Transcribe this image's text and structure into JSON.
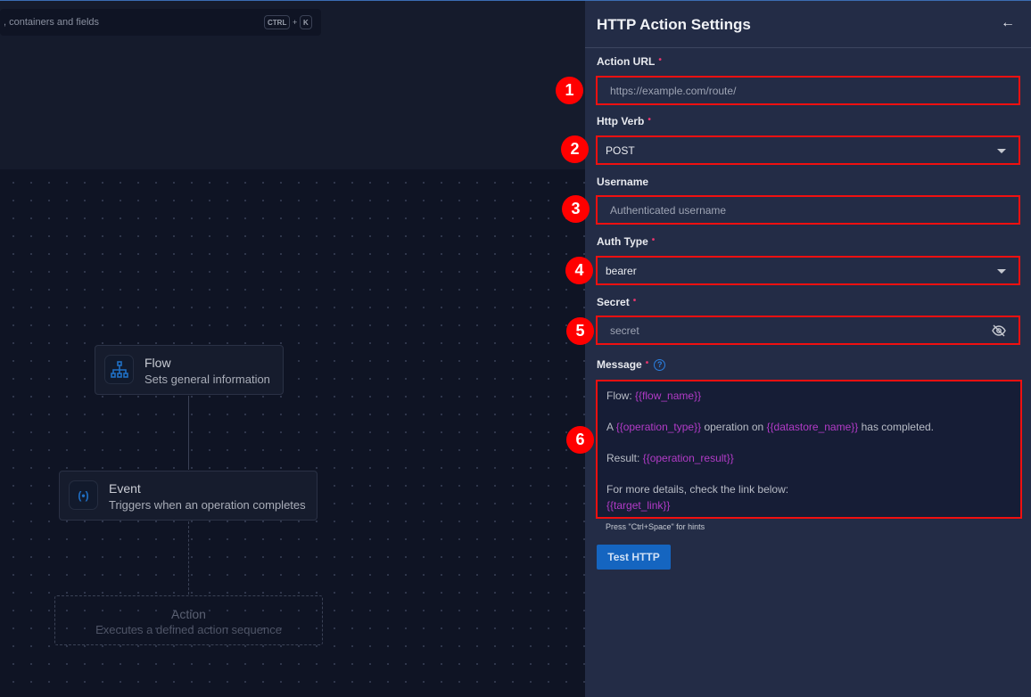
{
  "search": {
    "placeholder_fragment": ", containers and fields",
    "shortcut_key1": "CTRL",
    "shortcut_plus": "+",
    "shortcut_key2": "K"
  },
  "canvas": {
    "nodes": [
      {
        "title": "Flow",
        "subtitle": "Sets general information",
        "icon": "sitemap-icon"
      },
      {
        "title": "Event",
        "subtitle": "Triggers when an operation completes",
        "icon": "broadcast-icon"
      },
      {
        "title": "Action",
        "subtitle": "Executes a defined action sequence",
        "placeholder": true
      }
    ]
  },
  "panel": {
    "title": "HTTP Action Settings",
    "back_icon": "arrow-left-icon",
    "required_mark": "•",
    "fields": {
      "action_url": {
        "label": "Action URL",
        "placeholder": "https://example.com/route/",
        "required": true
      },
      "http_verb": {
        "label": "Http Verb",
        "value": "POST",
        "required": true
      },
      "username": {
        "label": "Username",
        "placeholder": "Authenticated username",
        "required": false
      },
      "auth_type": {
        "label": "Auth Type",
        "value": "bearer",
        "required": true
      },
      "secret": {
        "label": "Secret",
        "placeholder": "secret",
        "required": true
      },
      "message": {
        "label": "Message",
        "required": true,
        "l1a": "Flow: ",
        "l1v": "{{flow_name}}",
        "l2a": "A ",
        "l2v1": "{{operation_type}}",
        "l2b": " operation on ",
        "l2v2": "{{datastore_name}}",
        "l2c": " has completed.",
        "l3a": "Result: ",
        "l3v": "{{operation_result}}",
        "l4": "For more details, check the link below:",
        "l5v": "{{target_link}}",
        "hint": "Press \"Ctrl+Space\" for hints"
      }
    },
    "test_button": "Test HTTP"
  },
  "annotations": [
    "1",
    "2",
    "3",
    "4",
    "5",
    "6"
  ],
  "colors": {
    "accent": "#1565c0",
    "annotation": "#ff0000",
    "variable": "#b23bc7",
    "required": "#e5356d"
  }
}
